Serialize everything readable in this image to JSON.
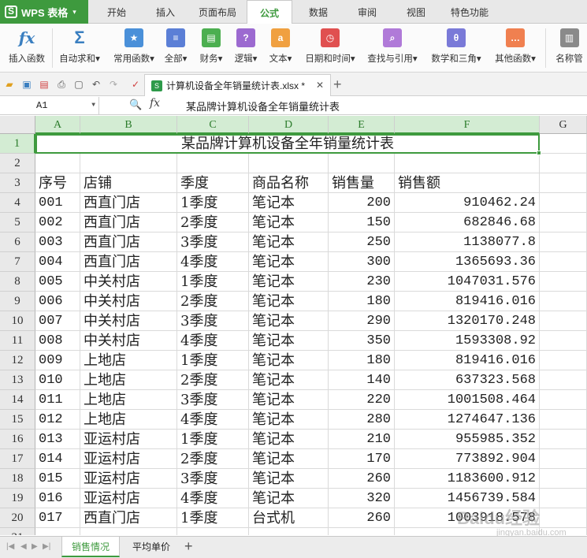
{
  "app": {
    "name": "WPS 表格"
  },
  "menu_tabs": [
    {
      "label": "开始",
      "x": 0
    },
    {
      "label": "插入"
    },
    {
      "label": "页面布局"
    },
    {
      "label": "公式"
    },
    {
      "label": "数据"
    },
    {
      "label": "审阅"
    },
    {
      "label": "视图"
    },
    {
      "label": "特色功能"
    }
  ],
  "ribbon": {
    "insert_function": "插入函数",
    "autosum": "自动求和",
    "common_functions": "常用函数",
    "all": "全部",
    "finance": "财务",
    "logic": "逻辑",
    "text": "文本",
    "datetime": "日期和时间",
    "lookup": "查找与引用",
    "math": "数学和三角",
    "other": "其他函数",
    "name_manager": "名称管"
  },
  "document_tab": {
    "filename": "计算机设备全年销量统计表.xlsx *"
  },
  "formula_bar": {
    "cell_ref": "A1",
    "fx": "fx",
    "content": "某品牌计算机设备全年销量统计表"
  },
  "columns": [
    "A",
    "B",
    "C",
    "D",
    "E",
    "F",
    "G"
  ],
  "sheet": {
    "title": "某品牌计算机设备全年销量统计表",
    "headers": [
      "序号",
      "店铺",
      "季度",
      "商品名称",
      "销售量",
      "销售额"
    ],
    "rows": [
      [
        "001",
        "西直门店",
        "1季度",
        "笔记本",
        "200",
        "910462.24"
      ],
      [
        "002",
        "西直门店",
        "2季度",
        "笔记本",
        "150",
        "682846.68"
      ],
      [
        "003",
        "西直门店",
        "3季度",
        "笔记本",
        "250",
        "1138077.8"
      ],
      [
        "004",
        "西直门店",
        "4季度",
        "笔记本",
        "300",
        "1365693.36"
      ],
      [
        "005",
        "中关村店",
        "1季度",
        "笔记本",
        "230",
        "1047031.576"
      ],
      [
        "006",
        "中关村店",
        "2季度",
        "笔记本",
        "180",
        "819416.016"
      ],
      [
        "007",
        "中关村店",
        "3季度",
        "笔记本",
        "290",
        "1320170.248"
      ],
      [
        "008",
        "中关村店",
        "4季度",
        "笔记本",
        "350",
        "1593308.92"
      ],
      [
        "009",
        "上地店",
        "1季度",
        "笔记本",
        "180",
        "819416.016"
      ],
      [
        "010",
        "上地店",
        "2季度",
        "笔记本",
        "140",
        "637323.568"
      ],
      [
        "011",
        "上地店",
        "3季度",
        "笔记本",
        "220",
        "1001508.464"
      ],
      [
        "012",
        "上地店",
        "4季度",
        "笔记本",
        "280",
        "1274647.136"
      ],
      [
        "013",
        "亚运村店",
        "1季度",
        "笔记本",
        "210",
        "955985.352"
      ],
      [
        "014",
        "亚运村店",
        "2季度",
        "笔记本",
        "170",
        "773892.904"
      ],
      [
        "015",
        "亚运村店",
        "3季度",
        "笔记本",
        "260",
        "1183600.912"
      ],
      [
        "016",
        "亚运村店",
        "4季度",
        "笔记本",
        "320",
        "1456739.584"
      ],
      [
        "017",
        "西直门店",
        "1季度",
        "台式机",
        "260",
        "1003918.578"
      ]
    ]
  },
  "row_numbers": [
    "1",
    "2",
    "3",
    "4",
    "5",
    "6",
    "7",
    "8",
    "9",
    "10",
    "11",
    "12",
    "13",
    "14",
    "15",
    "16",
    "17",
    "18",
    "19",
    "20",
    "21"
  ],
  "sheet_tabs": [
    "销售情况",
    "平均单价"
  ],
  "watermark": {
    "text": "Baidu经验",
    "url": "jingyan.baidu.com"
  },
  "colors": {
    "accent": "#3e9a3e"
  }
}
